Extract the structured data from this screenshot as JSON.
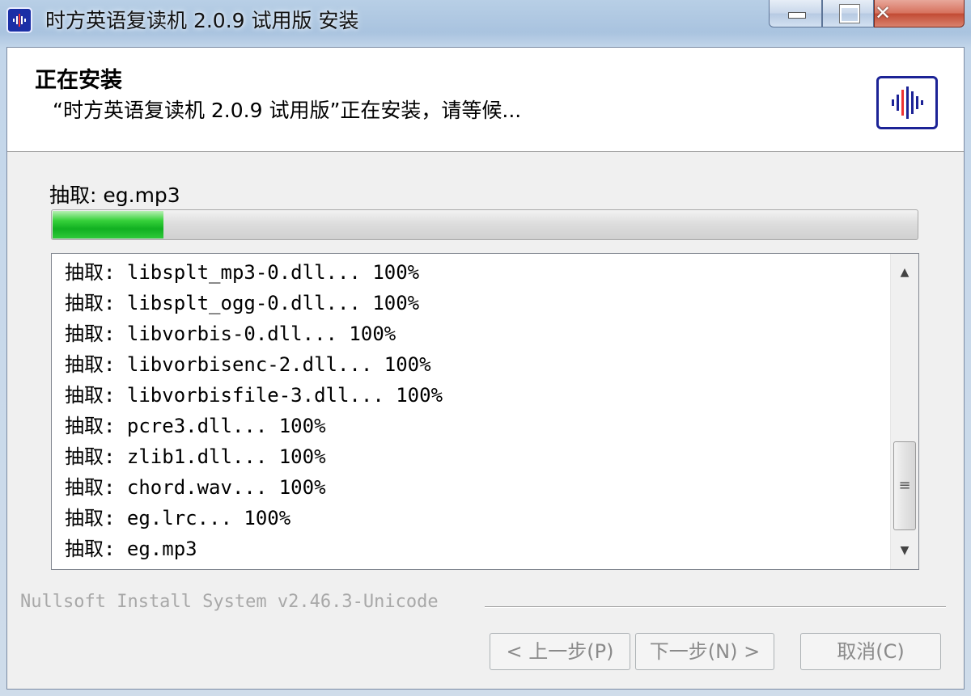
{
  "window": {
    "title": "时方英语复读机 2.0.9 试用版 安装",
    "close_label": "✕"
  },
  "header": {
    "title": "正在安装",
    "subtitle": "“时方英语复读机 2.0.9 试用版”正在安装，请等候..."
  },
  "progress": {
    "current_label": "抽取: eg.mp3",
    "percent": 13
  },
  "log": {
    "items": [
      "抽取: libsplt_mp3-0.dll... 100%",
      "抽取: libsplt_ogg-0.dll... 100%",
      "抽取: libvorbis-0.dll... 100%",
      "抽取: libvorbisenc-2.dll... 100%",
      "抽取: libvorbisfile-3.dll... 100%",
      "抽取: pcre3.dll... 100%",
      "抽取: zlib1.dll... 100%",
      "抽取: chord.wav... 100%",
      "抽取: eg.lrc... 100%",
      "抽取: eg.mp3"
    ]
  },
  "footer": {
    "branding": "Nullsoft Install System v2.46.3-Unicode",
    "back_label": "< 上一步(P)",
    "next_label": "下一步(N) >",
    "cancel_label": "取消(C)"
  },
  "icons": {
    "app": "sound-wave-icon",
    "header_logo": "sound-wave-logo",
    "scroll_up": "scroll-up-arrow-icon",
    "scroll_down": "scroll-down-arrow-icon"
  },
  "colors": {
    "progress_fill": "#11b021",
    "logo_blue": "#1c2396",
    "disabled_text": "#8a8a8a"
  }
}
